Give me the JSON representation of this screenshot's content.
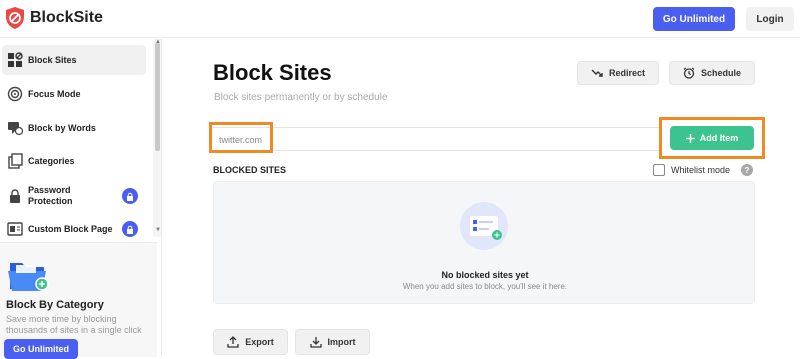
{
  "app": {
    "brand": "BlockSite",
    "logo_icon": "shield-icon",
    "accent": "#4a5ef0",
    "success": "#3dc48e",
    "highlight": "#f08a24"
  },
  "header": {
    "go_unlimited": "Go Unlimited",
    "login": "Login"
  },
  "sidebar": {
    "items": [
      {
        "label": "Block Sites",
        "icon": "block-sites-icon",
        "active": true
      },
      {
        "label": "Focus Mode",
        "icon": "focus-mode-icon"
      },
      {
        "label": "Block by Words",
        "icon": "block-words-icon"
      },
      {
        "label": "Categories",
        "icon": "categories-icon"
      },
      {
        "label": "Password Protection",
        "icon": "lock-icon",
        "locked": true
      },
      {
        "label": "Custom Block Page",
        "icon": "custom-page-icon",
        "locked": true
      }
    ],
    "promo": {
      "title": "Block By Category",
      "description": "Save more time by blocking thousands of sites in a single click",
      "button": "Go Unlimited"
    }
  },
  "main": {
    "title": "Block Sites",
    "subtitle": "Block sites permanently or by schedule",
    "redirect": "Redirect",
    "schedule": "Schedule",
    "url_input_value": "twitter.com",
    "add_item": "Add Item",
    "blocked_sites_label": "BLOCKED SITES",
    "whitelist_mode": "Whitelist mode",
    "empty_title": "No blocked sites yet",
    "empty_desc": "When you add sites to block, you'll see it here.",
    "export": "Export",
    "import": "Import"
  }
}
